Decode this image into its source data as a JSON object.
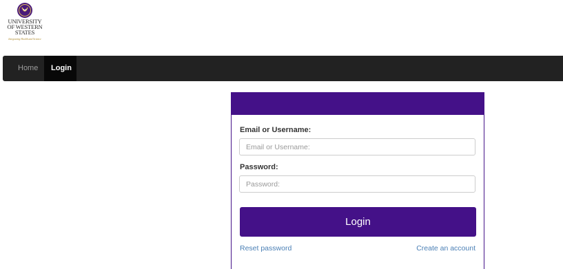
{
  "header": {
    "logo": {
      "icon": "university-crest-icon",
      "line1": "UNIVERSITY",
      "line2": "OF WESTERN",
      "line3": "STATES",
      "tagline": "Integrating Health and Science"
    }
  },
  "nav": {
    "items": [
      {
        "label": "Home",
        "active": false
      },
      {
        "label": "Login",
        "active": true
      }
    ]
  },
  "login_form": {
    "username_label": "Email or Username:",
    "username_placeholder": "Email or Username:",
    "username_value": "",
    "password_label": "Password:",
    "password_placeholder": "Password:",
    "password_value": "",
    "submit_label": "Login",
    "reset_link": "Reset password",
    "create_link": "Create an account"
  },
  "colors": {
    "brand_purple": "#441188",
    "navbar": "#222222",
    "link": "#4a7fb5",
    "logo_gold": "#b08a2a"
  }
}
